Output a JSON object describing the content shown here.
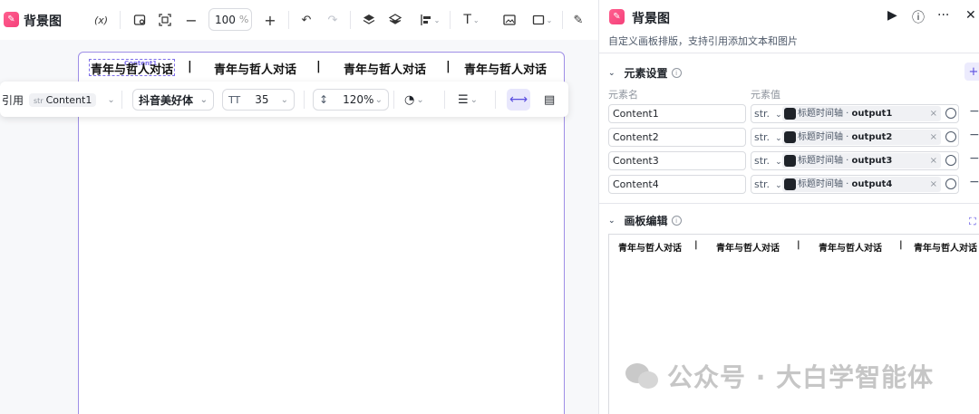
{
  "editor": {
    "title": "背景图",
    "toolbar": {
      "variable_label": "(x)",
      "zoom_value": "100",
      "zoom_unit": "%"
    },
    "canvas": {
      "texts": [
        "青年与哲人对话",
        "|",
        "青年与哲人对话",
        "|",
        "青年与哲人对话",
        "|",
        "青年与哲人对话"
      ],
      "selection_tag": "Content1"
    },
    "format_bar": {
      "ref_label": "引用",
      "ref_chip_type": "str",
      "ref_chip_value": "Content1",
      "font_name": "抖音美好体",
      "font_size": "35",
      "line_height": "120%"
    }
  },
  "panel": {
    "title": "背景图",
    "description": "自定义画板排版，支持引用添加文本和图片",
    "element_settings": {
      "title": "元素设置",
      "col_name": "元素名",
      "col_value": "元素值",
      "rows": [
        {
          "name": "Content1",
          "type": "str.",
          "source": "标题时间轴 ·",
          "output": "output1"
        },
        {
          "name": "Content2",
          "type": "str.",
          "source": "标题时间轴 ·",
          "output": "output2"
        },
        {
          "name": "Content3",
          "type": "str.",
          "source": "标题时间轴 ·",
          "output": "output3"
        },
        {
          "name": "Content4",
          "type": "str.",
          "source": "标题时间轴 ·",
          "output": "output4"
        }
      ]
    },
    "board_edit": {
      "title": "画板编辑",
      "texts": [
        "青年与哲人对话",
        "|",
        "青年与哲人对话",
        "|",
        "青年与哲人对话",
        "|",
        "青年与哲人对话"
      ]
    }
  },
  "watermark": "公众号 · 大白学智能体",
  "colors": {
    "accent": "#5b4fe0",
    "brand": "#f5407a"
  }
}
